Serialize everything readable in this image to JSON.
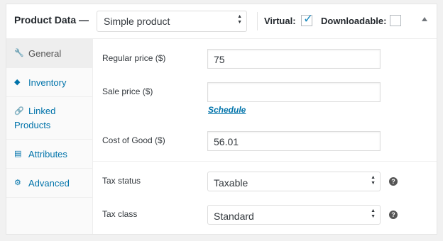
{
  "header": {
    "title": "Product Data —",
    "product_type": "Simple product",
    "virtual_label": "Virtual:",
    "virtual_checked": true,
    "downloadable_label": "Downloadable:",
    "downloadable_checked": false
  },
  "tabs": [
    {
      "label": "General",
      "icon": "wrench-icon",
      "active": true
    },
    {
      "label": "Inventory",
      "icon": "tag-icon",
      "active": false
    },
    {
      "label": "Linked Products",
      "icon": "link-icon",
      "active": false
    },
    {
      "label": "Attributes",
      "icon": "list-icon",
      "active": false
    },
    {
      "label": "Advanced",
      "icon": "gear-icon",
      "active": false
    }
  ],
  "fields": {
    "regular_price": {
      "label": "Regular price ($)",
      "value": "75"
    },
    "sale_price": {
      "label": "Sale price ($)",
      "value": ""
    },
    "schedule_link": "Schedule",
    "cost_of_good": {
      "label": "Cost of Good ($)",
      "value": "56.01"
    },
    "tax_status": {
      "label": "Tax status",
      "value": "Taxable"
    },
    "tax_class": {
      "label": "Tax class",
      "value": "Standard"
    }
  },
  "colors": {
    "link": "#0073aa",
    "checkmark": "#1e8cbe"
  }
}
